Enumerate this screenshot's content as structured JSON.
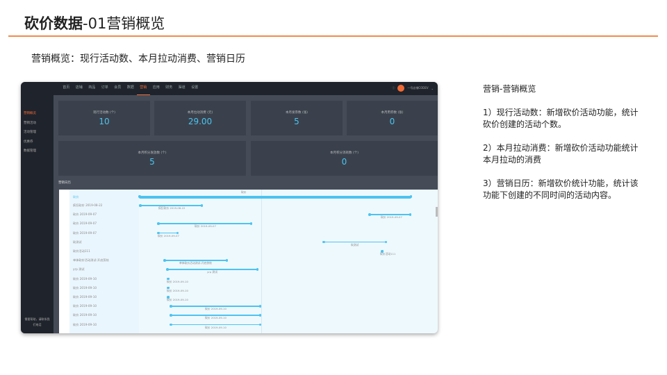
{
  "header": {
    "title_bold": "砍价数据",
    "title_rest": "-01营销概览"
  },
  "subtitle": "营销概览：现行活动数、本月拉动消费、营销日历",
  "notes": {
    "heading": "营销-营销概览",
    "items": [
      "1）现行活动数：新增砍价活动功能，统计砍价创建的活动个数。",
      "2）本月拉动消费：新增砍价活动功能统计本月拉动的消费",
      "3）营销日历：新增砍价统计功能，统计该功能下创建的不同时间的活动内容。"
    ]
  },
  "app": {
    "nav": [
      "首页",
      "店铺",
      "商品",
      "订单",
      "会员",
      "数据",
      "营销",
      "应用",
      "财务",
      "渠道",
      "设置"
    ],
    "nav_active": 6,
    "user": "一号店铺CODEV",
    "sidebar": [
      "营销概览",
      "营销活动",
      "活动管理",
      "优惠券",
      "数据管理"
    ],
    "sidebar_help": "需要帮助，请联系我们电话",
    "cards": [
      {
        "label": "现行活动数 (个)",
        "value": "10"
      },
      {
        "label": "本月拉动消费 (元)",
        "value": "29.00"
      },
      {
        "label": "本月发券数 (张)",
        "value": "5"
      },
      {
        "label": "本月用券数 (张)",
        "value": "0"
      },
      {
        "label": "本月积分发放数 (个)",
        "value": "5"
      },
      {
        "label": "本月积分消耗数 (个)",
        "value": "0"
      }
    ],
    "calendar_title": "营销日历",
    "group": "砍价",
    "rows": [
      "疯狂砍价 2019-08-22",
      "砍价 2019-09-07",
      "砍价 2019-09-07",
      "砍价 2019-09-07",
      "砍测试",
      "砍价活动111",
      "单体砍价活动测试-开启剪枝",
      "yrp 测试",
      "砍价 2019-09-10",
      "砍价 2019-09-10",
      "砍价 2019-09-10",
      "砍价 2019-09-10",
      "砍价 2019-09-10",
      "砍价 2019-09-10"
    ]
  }
}
